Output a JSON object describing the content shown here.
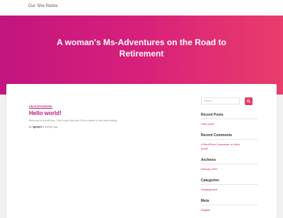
{
  "site": {
    "name": "Our She Retire"
  },
  "hero": {
    "title": "A woman's Ms-Adventures on the Road to Retirement"
  },
  "post": {
    "category": "UNCATEGORIZED",
    "title": "Hello world!",
    "excerpt": "Welcome to WordPress. This is your first post. Edit or delete it, then start writing!",
    "by": "By",
    "author": "sgray01",
    "date": "8 months ago"
  },
  "sidebar": {
    "search": {
      "placeholder": "Search …",
      "button_icon": "search-icon"
    },
    "recent_posts": {
      "title": "Recent Posts",
      "items": [
        "Hello world!"
      ]
    },
    "recent_comments": {
      "title": "Recent Comments",
      "commenter": "A WordPress Commenter",
      "connector": "on",
      "post_line1": "Hello",
      "post_line2": "world!"
    },
    "archives": {
      "title": "Archives",
      "items": [
        "February 2020"
      ]
    },
    "categories": {
      "title": "Categories",
      "items": [
        "Uncategorized"
      ]
    },
    "meta": {
      "title": "Meta",
      "items": [
        "Register"
      ]
    }
  },
  "colors": {
    "accent": "#c3157f",
    "hero_start": "#c3157f",
    "hero_end": "#ea3d6b",
    "button": "#e63b6a"
  }
}
